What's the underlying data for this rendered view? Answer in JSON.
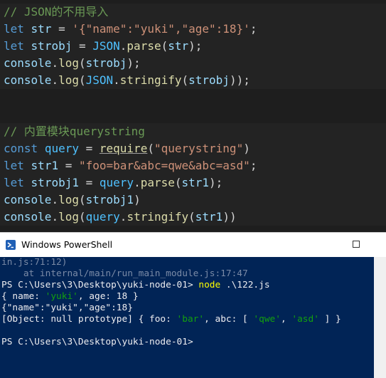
{
  "editor": {
    "block1": {
      "comment": "// JSON的不用导入",
      "l2": {
        "kw": "let",
        "var": "str",
        "eq": " = ",
        "str": "'{\"name\":\"yuki\",\"age\":18}'",
        "end": ";"
      },
      "l3": {
        "kw": "let",
        "var": "strobj",
        "eq": " = ",
        "obj": "JSON",
        "dot": ".",
        "fn": "parse",
        "open": "(",
        "arg": "str",
        "close": ");"
      },
      "l4": {
        "obj": "console",
        "dot": ".",
        "fn": "log",
        "open": "(",
        "arg": "strobj",
        "close": ");"
      },
      "l5": {
        "obj": "console",
        "dot": ".",
        "fn": "log",
        "open": "(",
        "obj2": "JSON",
        "dot2": ".",
        "fn2": "stringify",
        "open2": "(",
        "arg": "strobj",
        "close": "));"
      }
    },
    "block2": {
      "comment": "// 内置模块querystring",
      "l2": {
        "kw": "const",
        "var": "query",
        "eq": " = ",
        "fn": "require",
        "open": "(",
        "str": "\"querystring\"",
        "close": ")"
      },
      "l3": {
        "kw": "let",
        "var": "str1",
        "eq": " = ",
        "str": "\"foo=bar&abc=qwe&abc=asd\"",
        "end": ";"
      },
      "l4": {
        "kw": "let",
        "var": "strobj1",
        "eq": " = ",
        "obj": "query",
        "dot": ".",
        "fn": "parse",
        "open": "(",
        "arg": "str1",
        "close": ");"
      },
      "l5": {
        "obj": "console",
        "dot": ".",
        "fn": "log",
        "open": "(",
        "arg": "strobj1",
        "close": ")"
      },
      "l6": {
        "obj": "console",
        "dot": ".",
        "fn": "log",
        "open": "(",
        "obj2": "query",
        "dot2": ".",
        "fn2": "stringify",
        "open2": "(",
        "arg": "str1",
        "close": "))"
      }
    }
  },
  "powershell": {
    "title": "Windows PowerShell",
    "lines": {
      "l1": "in.js:71:12)",
      "l2": "    at internal/main/run_main_module.js:17:47",
      "l3_prompt": "PS C:\\Users\\3\\Desktop\\yuki-node-01> ",
      "l3_cmd": "node",
      "l3_arg": " .\\122.js",
      "l4_a": "{ name: ",
      "l4_b": "'yuki'",
      "l4_c": ", age: 18 }",
      "l5": "{\"name\":\"yuki\",\"age\":18}",
      "l6_a": "[Object: null prototype] { foo: ",
      "l6_b": "'bar'",
      "l6_c": ", abc: [ ",
      "l6_d": "'qwe'",
      "l6_e": ", ",
      "l6_f": "'asd'",
      "l6_g": " ] }",
      "l8": "PS C:\\Users\\3\\Desktop\\yuki-node-01>"
    }
  },
  "colors": {
    "editor_bg": "#1e1e1e",
    "console_bg": "#012456",
    "keyword": "#569cd6",
    "string": "#ce9178",
    "comment": "#6a9955",
    "function": "#dcdcaa"
  }
}
